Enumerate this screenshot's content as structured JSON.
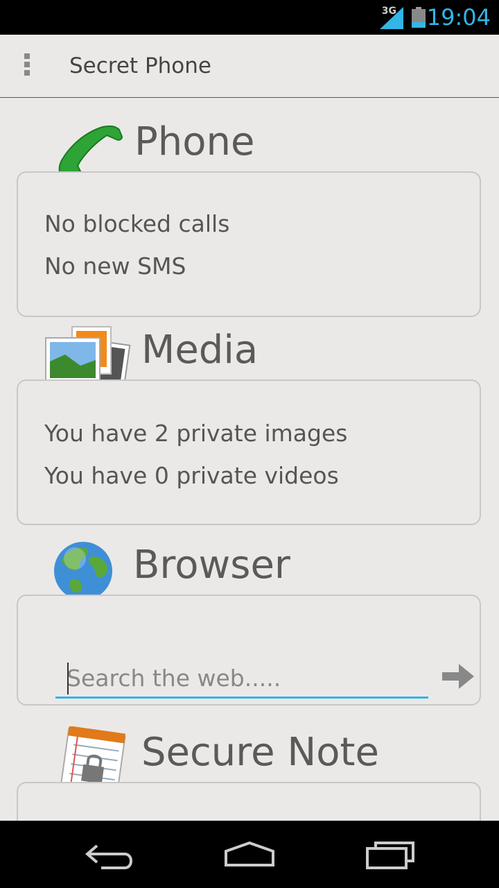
{
  "status_bar": {
    "network": "3G",
    "time": "19:04",
    "accent_color": "#33b5e5"
  },
  "action_bar": {
    "menu_icon": "overflow-menu-icon",
    "title": "Secret Phone"
  },
  "sections": {
    "phone": {
      "title": "Phone",
      "icon": "phone-handset-icon",
      "lines": [
        "No blocked calls",
        "No new SMS"
      ]
    },
    "media": {
      "title": "Media",
      "icon": "gallery-icon",
      "lines": [
        "You have 2 private images",
        "You have 0 private videos"
      ]
    },
    "browser": {
      "title": "Browser",
      "icon": "globe-icon",
      "search_value": "",
      "search_placeholder": "Search the web.....",
      "go_icon": "arrow-right-icon"
    },
    "secure_note": {
      "title": "Secure Note",
      "icon": "locked-notepad-icon"
    }
  },
  "nav_bar": {
    "back_icon": "back-icon",
    "home_icon": "home-icon",
    "recents_icon": "recent-apps-icon"
  }
}
